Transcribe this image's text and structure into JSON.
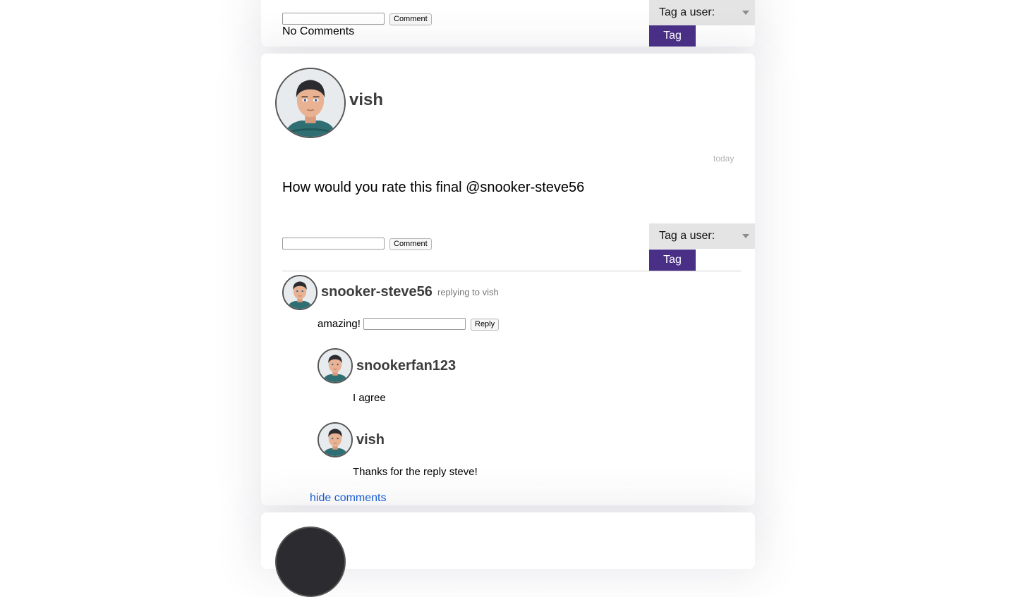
{
  "previous_post": {
    "comment_button": "Comment",
    "no_comments": "No Comments",
    "tag_select_label": "Tag a user:",
    "tag_button": "Tag"
  },
  "post": {
    "author": "vish",
    "timestamp": "today",
    "body": "How would you rate this final @snooker-steve56",
    "comment_button": "Comment",
    "tag_select_label": "Tag a user:",
    "tag_button": "Tag",
    "hide_comments_link": "hide comments",
    "comments": [
      {
        "author": "snooker-steve56",
        "replying_to": "replying to vish",
        "text": "amazing!",
        "reply_button": "Reply",
        "replies": [
          {
            "author": "snookerfan123",
            "text": "I agree"
          },
          {
            "author": "vish",
            "text": "Thanks for the reply steve!"
          }
        ]
      }
    ]
  },
  "colors": {
    "accent": "#4a2f87",
    "link": "#1a5fd6",
    "username": "#3c3c3c",
    "muted": "#777777"
  },
  "icons": {
    "avatar": "cartoon-user-avatar-icon",
    "dropdown": "dropdown-caret-icon"
  }
}
